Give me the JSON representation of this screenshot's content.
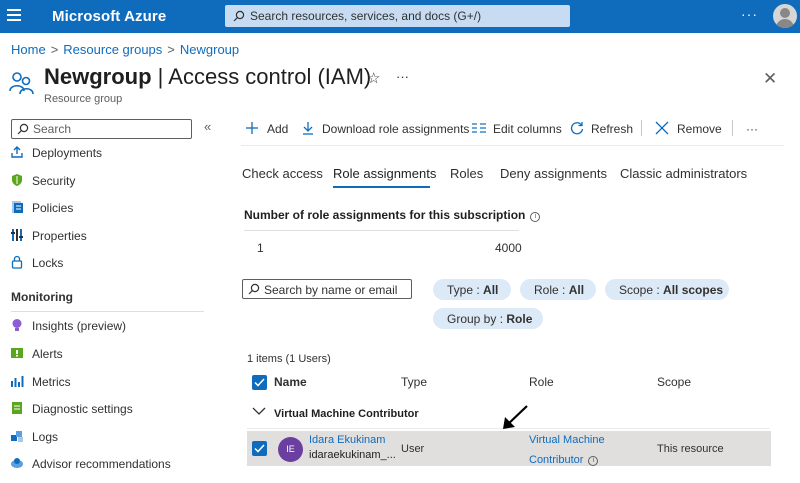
{
  "topbar": {
    "brand": "Microsoft Azure",
    "search_placeholder": "Search resources, services, and docs (G+/)",
    "more": "···",
    "accent": "#0f6cbd"
  },
  "breadcrumb": [
    "Home",
    "Resource groups",
    "Newgroup"
  ],
  "header": {
    "title_bold": "Newgroup",
    "title_rest": " | Access control (IAM)",
    "subtitle": "Resource group",
    "more": "···"
  },
  "sidebar": {
    "search_placeholder": "Search",
    "collapse": "«",
    "items": [
      {
        "label": "Deployments",
        "icon": "deployments-icon"
      },
      {
        "label": "Security",
        "icon": "shield-icon"
      },
      {
        "label": "Policies",
        "icon": "policies-icon"
      },
      {
        "label": "Properties",
        "icon": "properties-icon"
      },
      {
        "label": "Locks",
        "icon": "lock-icon"
      }
    ],
    "section": "Monitoring",
    "monitoring_items": [
      {
        "label": "Insights (preview)",
        "icon": "insights-icon"
      },
      {
        "label": "Alerts",
        "icon": "alerts-icon"
      },
      {
        "label": "Metrics",
        "icon": "metrics-icon"
      },
      {
        "label": "Diagnostic settings",
        "icon": "diagnostic-settings-icon"
      },
      {
        "label": "Logs",
        "icon": "logs-icon"
      },
      {
        "label": "Advisor recommendations",
        "icon": "advisor-icon"
      }
    ]
  },
  "toolbar": {
    "add": "Add",
    "download": "Download role assignments",
    "edit_columns": "Edit columns",
    "refresh": "Refresh",
    "remove": "Remove",
    "more": "···"
  },
  "tabs": [
    {
      "label": "Check access",
      "active": false
    },
    {
      "label": "Role assignments",
      "active": true
    },
    {
      "label": "Roles",
      "active": false
    },
    {
      "label": "Deny assignments",
      "active": false
    },
    {
      "label": "Classic administrators",
      "active": false
    }
  ],
  "assignments_count": {
    "label": "Number of role assignments for this subscription",
    "info": "i",
    "value": "1",
    "max": "4000"
  },
  "filters": {
    "search_placeholder": "Search by name or email",
    "type": {
      "key": "Type : ",
      "value": "All"
    },
    "role": {
      "key": "Role : ",
      "value": "All"
    },
    "scope": {
      "key": "Scope : ",
      "value": "All scopes"
    },
    "group_by": {
      "key": "Group by : ",
      "value": "Role"
    }
  },
  "table": {
    "items_count": "1 items (1 Users)",
    "columns": [
      "Name",
      "Type",
      "Role",
      "Scope"
    ],
    "group": "Virtual Machine Contributor",
    "rows": [
      {
        "initials": "IE",
        "name": "Idara Ekukinam",
        "email": "idaraekukinam_...",
        "type": "User",
        "role_line1": "Virtual Machine",
        "role_line2": "Contributor",
        "scope": "This resource",
        "selected": true
      }
    ]
  }
}
